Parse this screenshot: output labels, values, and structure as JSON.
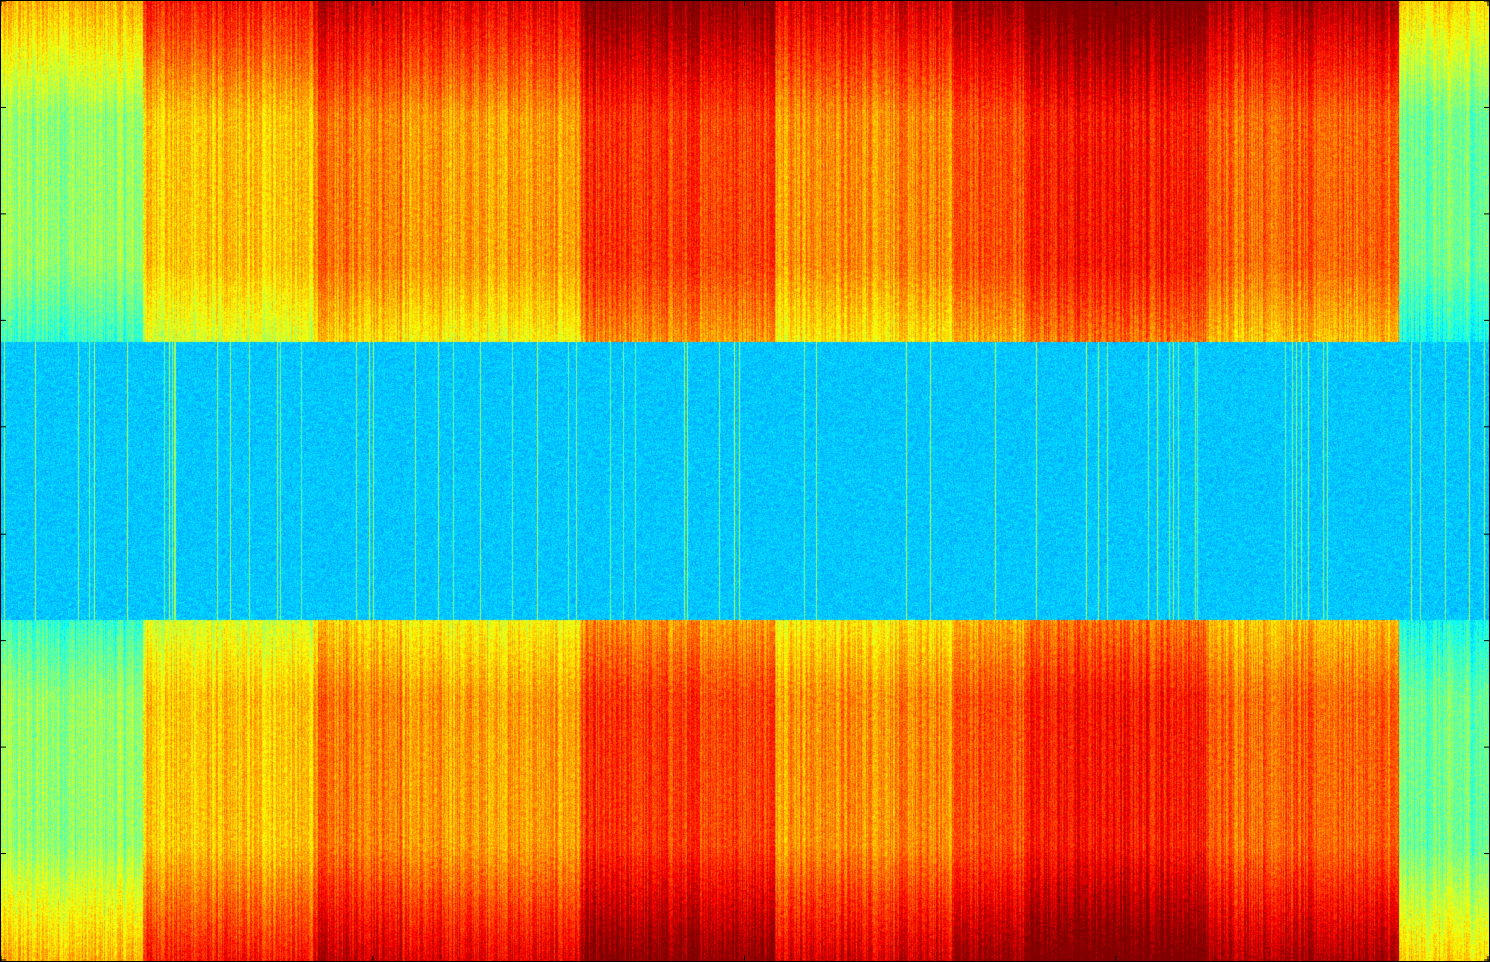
{
  "chart_data": {
    "type": "heatmap",
    "title": "",
    "xlabel": "",
    "ylabel": "",
    "colormap": "jet",
    "grid": false,
    "legend": "none",
    "xlim": [
      0,
      1
    ],
    "ylim": [
      0,
      1
    ],
    "x_ticks": [
      0.0,
      0.25,
      0.5,
      0.75,
      1.0
    ],
    "y_ticks": [
      0.0,
      0.111,
      0.222,
      0.333,
      0.444,
      0.556,
      0.667,
      0.778,
      0.889,
      1.0
    ],
    "colors": {
      "low": "#1e90ff",
      "band": "#00d8f0",
      "mid": "#7cf08a",
      "high": "#f5f518",
      "higher": "#ff9a00",
      "max": "#ff4a00"
    },
    "band": {
      "y_range": [
        0.355,
        0.645
      ],
      "value": 0.32
    },
    "column_segments": [
      {
        "x": [
          0.0,
          0.095
        ],
        "value": 0.52
      },
      {
        "x": [
          0.095,
          0.21
        ],
        "value": 0.68
      },
      {
        "x": [
          0.21,
          0.27
        ],
        "value": 0.76
      },
      {
        "x": [
          0.27,
          0.39
        ],
        "value": 0.72
      },
      {
        "x": [
          0.39,
          0.52
        ],
        "value": 0.82
      },
      {
        "x": [
          0.52,
          0.64
        ],
        "value": 0.74
      },
      {
        "x": [
          0.64,
          0.69
        ],
        "value": 0.8
      },
      {
        "x": [
          0.69,
          0.81
        ],
        "value": 0.86
      },
      {
        "x": [
          0.81,
          0.94
        ],
        "value": 0.78
      },
      {
        "x": [
          0.94,
          1.0
        ],
        "value": 0.48
      }
    ]
  }
}
